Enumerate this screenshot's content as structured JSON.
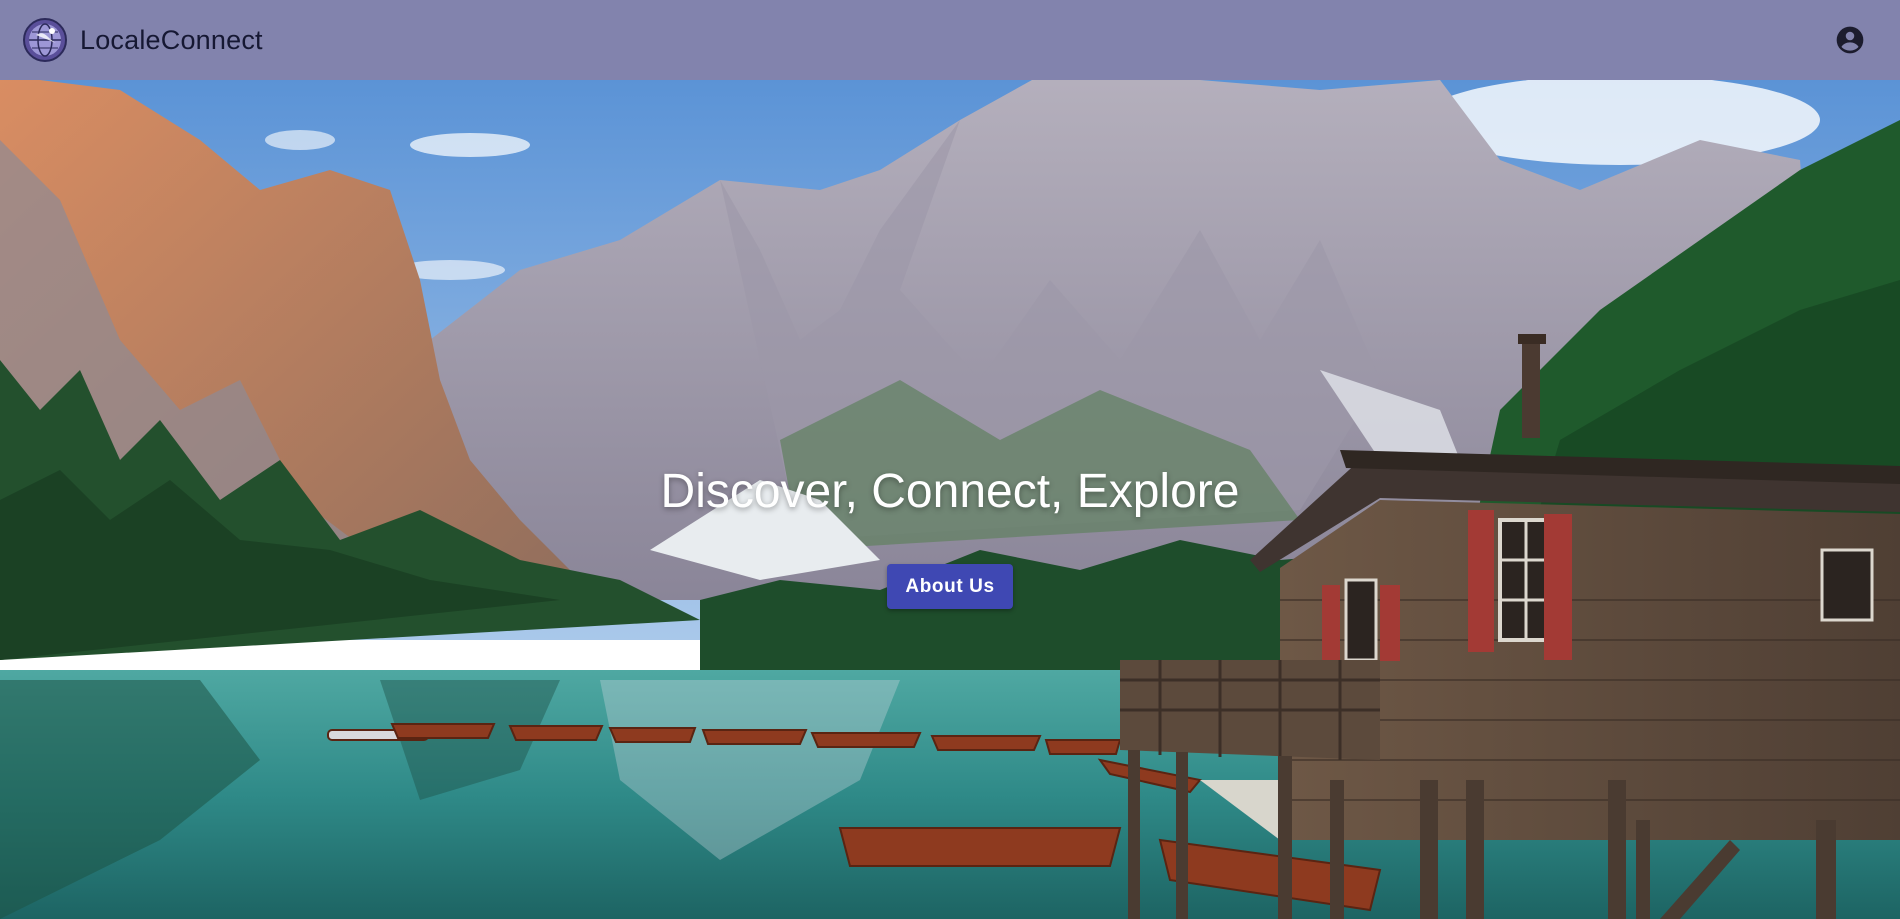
{
  "app": {
    "brand_name": "LocaleConnect",
    "logo_icon": "globe-logo-icon",
    "account_icon": "account-circle-icon",
    "bar_color": "#8283ad"
  },
  "hero": {
    "headline": "Discover, Connect, Explore",
    "cta_label": "About Us",
    "cta_color": "#3f48b3",
    "background_image": "alpine lake with mountains, rowboats and wooden boathouse"
  }
}
